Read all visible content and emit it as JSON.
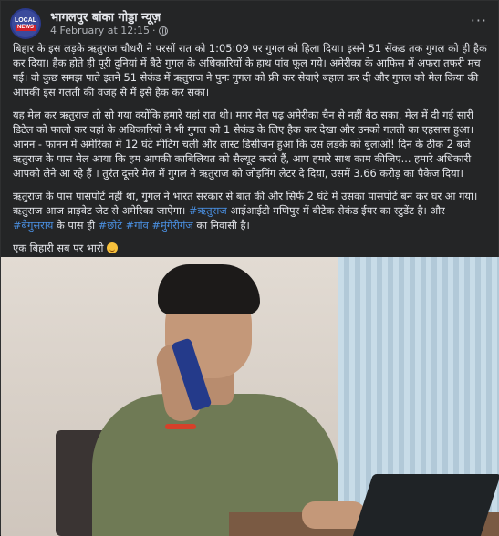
{
  "post": {
    "page_name": "भागलपुर बांका गोड्डा न्यूज़",
    "timestamp": "4 February at 12:15",
    "meta_separator": "·",
    "avatar_line1": "LOCAL",
    "avatar_line2": "NEWS",
    "more_label": "···",
    "audience_icon": "globe-icon"
  },
  "body": {
    "p1": "बिहार के इस लड़के ऋतुराज चौधरी ने परसों रात को 1:05:09 पर गुगल को हिला दिया। इसने 51 सेंकड तक गुगल को ही हैक कर दिया। हैक होते ही पूरी दुनियां में बैठे गुगल के अधिकारियों के हाथ पांव फूल गये। अमेरीका के आफिस में अफरा तफरी मच गई। वो कुछ समझ पाते इतने 51 सेकंड में ऋतुराज ने पुनः गुगल को फ्री कर सेवाऐ बहाल कर दी और गुगल को मेल किया की आपकी इस गलती की वजह से मैं इसे हैक कर सका।",
    "p2": "यह मेल कर ऋतुराज तो सो गया क्योंकि हमारे यहां रात थी। मगर मेल पढ़ अमेरीका चैन से नहीं बैठ सका, मेल में दी गई सारी डिटेल को फालो कर वहां के अधिकारियों ने भी गुगल को 1 सेकंड के लिए हैक कर देखा और उनको गलती का एहसास हुआ। आनन - फानन में अमेरिका में 12 घंटे मीटिंग चली और लास्ट डिसीजन हुआ कि उस लड़के को बुलाओ! दिन के ठीक 2 बजे ऋतुराज के पास मेल आया कि हम आपकी काबिलियत को सैल्यूट करते हैं, आप हमारे साथ काम कीजिए... हमारे अधिकारी आपको लेने आ रहे हैं । तुरंत दूसरे मेल में गुगल ने ऋतुराज को जोइनिंग लेटर दे दिया, उसमें 3.66 करोड़ का पैकेज दिया।",
    "p3_a": "ऋतुराज के पास पासपोर्ट नहीं था, गुगल ने भारत सरकार से बात की और सिर्फ 2 घंटे में उसका पासपोर्ट बन कर घर आ गया। ऋतुराज आज प्राइवेट जेट से अमेरिका जाऐगा। ",
    "p3_tag1": "#ऋतुराज",
    "p3_b": " आईआईटी मणिपुर में बीटेक सेकंड ईयर का स्टुडेंट है। और ",
    "p3_tag2": "#बेगुसराय",
    "p3_c": " के पास ही ",
    "p3_tag3": "#छोटे",
    "p3_sp1": " ",
    "p3_tag4": "#गांव",
    "p3_sp2": " ",
    "p3_tag5": "#मुंगेरीगंज",
    "p3_d": " का निवासी है।",
    "p4": "एक बिहारी सब पर भारी ",
    "p4_emoji": "smiling-face-with-hearts-icon"
  },
  "photo": {
    "subject": "post-photo"
  }
}
